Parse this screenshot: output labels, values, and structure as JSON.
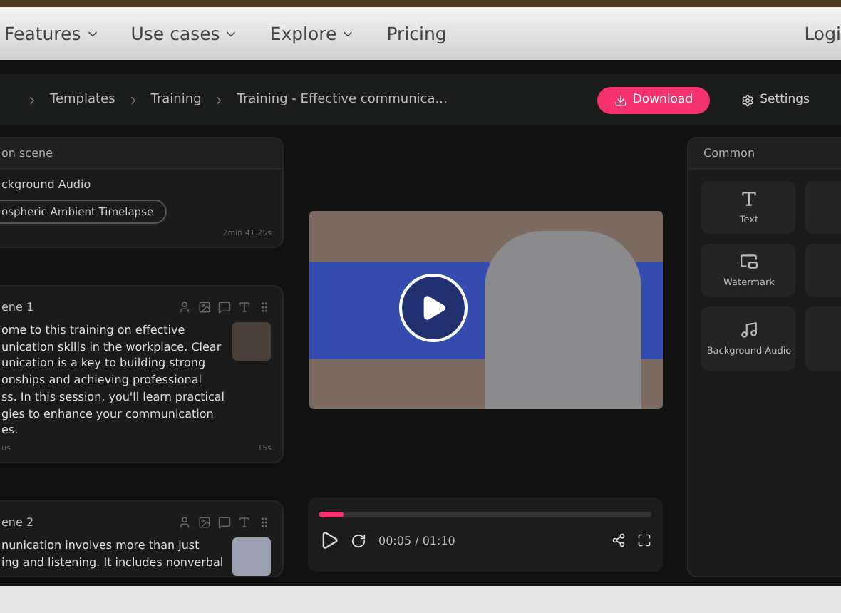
{
  "nav": {
    "items": [
      {
        "label": "Features",
        "dropdown": true
      },
      {
        "label": "Use cases",
        "dropdown": true
      },
      {
        "label": "Explore",
        "dropdown": true
      },
      {
        "label": "Pricing",
        "dropdown": false
      }
    ],
    "login": "Logi"
  },
  "breadcrumbs": [
    "Templates",
    "Training",
    "Training - Effective communica..."
  ],
  "actions": {
    "download": "Download",
    "settings": "Settings"
  },
  "audio_card": {
    "title": "on scene",
    "label": "ckground Audio",
    "track": "ospheric Ambient Timelapse",
    "duration": "2min 41.25s"
  },
  "scenes": [
    {
      "title": "ene 1",
      "lines": [
        "ome to this training on effective",
        "unication skills in the workplace. Clear",
        "unication is a key to building strong",
        "onships and achieving professional",
        "ss. In this session, you'll learn practical",
        "gies to enhance your communication",
        "es."
      ],
      "footer_left": "us",
      "duration": "15s"
    },
    {
      "title": "ene 2",
      "lines": [
        "nunication involves more than just",
        "ing and listening. It includes nonverbal"
      ]
    }
  ],
  "player": {
    "level": 0.07,
    "time": "00:05 / 01:10"
  },
  "common": {
    "title": "Common",
    "tiles": [
      {
        "kind": "text",
        "label": "Text"
      },
      {
        "kind": "blank"
      },
      {
        "kind": "watermark",
        "label": "Watermark"
      },
      {
        "kind": "blank"
      },
      {
        "kind": "audio",
        "label": "Background Audio"
      },
      {
        "kind": "blank"
      }
    ]
  }
}
